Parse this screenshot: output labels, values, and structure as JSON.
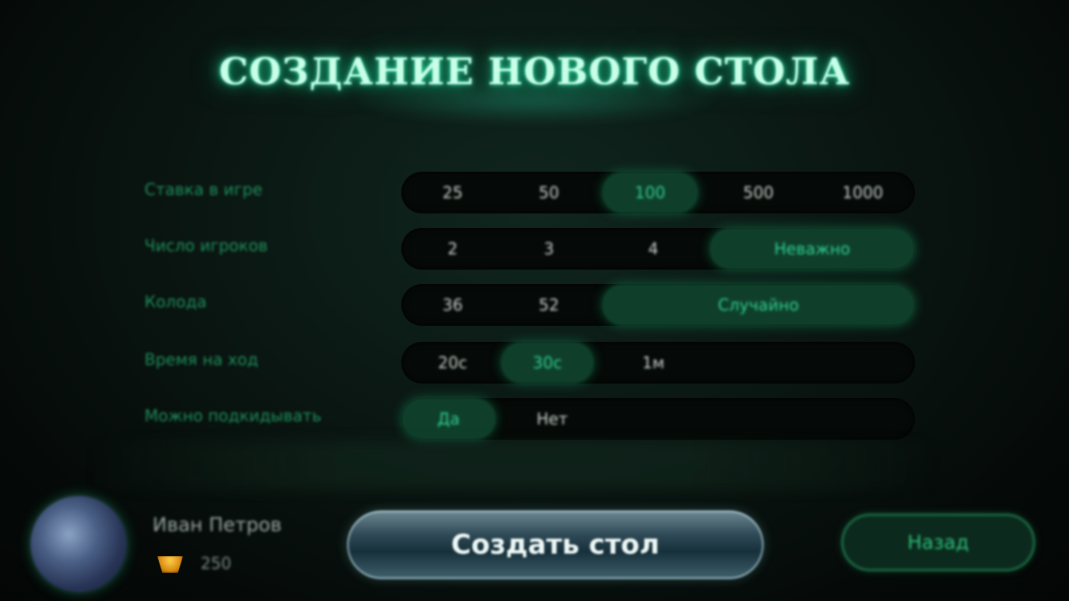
{
  "title": "СОЗДАНИЕ НОВОГО СТОЛА",
  "settings": [
    {
      "label": "Ставка в игре",
      "options": [
        "25",
        "50",
        "100",
        "500",
        "1000"
      ],
      "selected": 2
    },
    {
      "label": "Число игроков",
      "options": [
        "2",
        "3",
        "4",
        "Неважно"
      ],
      "selected": 3
    },
    {
      "label": "Колода",
      "options": [
        "36",
        "52",
        "Случайно"
      ],
      "selected": 2
    },
    {
      "label": "Время на ход",
      "options": [
        "20с",
        "30с",
        "1м"
      ],
      "selected": 1
    },
    {
      "label": "Можно подкидывать",
      "options": [
        "Да",
        "Нет"
      ],
      "selected": 0
    }
  ],
  "player": {
    "name": "Иван Петров",
    "chips": "250"
  },
  "buttons": {
    "create": "Создать стол",
    "back": "Назад"
  },
  "colors": {
    "accent": "#2fcf8e",
    "selected_bg": "#0f3f2b",
    "background": "#0a1612"
  },
  "icons": {
    "chips": "coin-stack-icon"
  }
}
